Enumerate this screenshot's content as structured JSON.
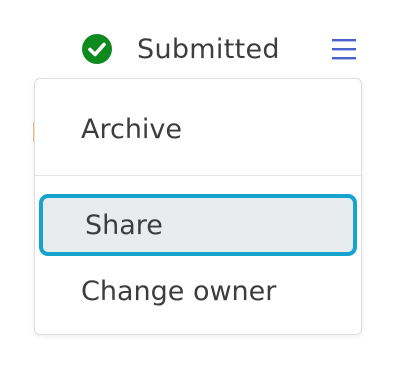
{
  "status": {
    "label": "Submitted",
    "icon": "check-circle-icon",
    "icon_color": "#0f8a1f"
  },
  "menu_toggle": {
    "icon": "hamburger-menu-icon",
    "color": "#4a63c8"
  },
  "dropdown": {
    "items": [
      {
        "label": "Archive"
      },
      {
        "label": "Share",
        "highlighted": true
      },
      {
        "label": "Change owner"
      }
    ],
    "highlight_color": "#15a3cf"
  }
}
